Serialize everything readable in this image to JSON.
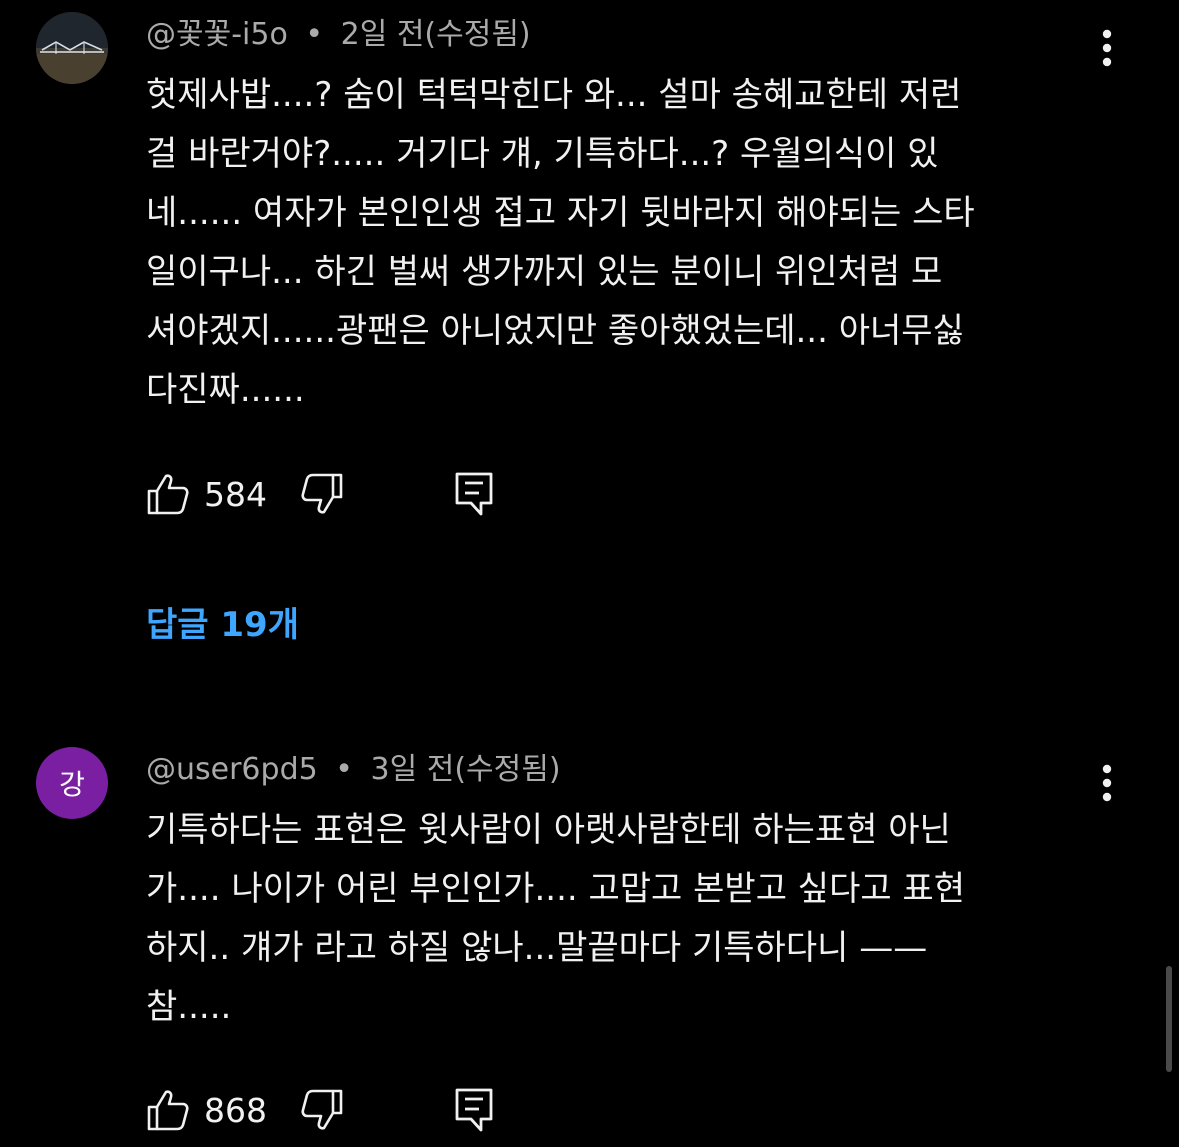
{
  "comments": [
    {
      "author": "@꽃꽃-i5o",
      "separator": "•",
      "time": "2일 전(수정됨)",
      "avatar_letter": "",
      "lines": [
        "헛제사밥....? 숨이 턱턱막힌다 와... 설마 송혜교한테 저런",
        "걸 바란거야?..... 거기다 걔, 기특하다...? 우월의식이 있",
        "네...... 여자가 본인인생 접고 자기 뒷바라지 해야되는 스타",
        "일이구나... 하긴 벌써 생가까지 있는 분이니 위인처럼 모",
        "셔야겠지......광팬은 아니었지만 좋아했었는데... 아너무싫",
        "다진짜......"
      ],
      "likes": "584",
      "replies_label": "답글 19개"
    },
    {
      "author": "@user6pd5",
      "separator": "•",
      "time": "3일 전(수정됨)",
      "avatar_letter": "강",
      "lines": [
        "기특하다는 표현은 윗사람이 아랫사람한테 하는표현 아닌",
        "가.... 나이가 어린 부인인가.... 고맙고 본받고 싶다고 표현",
        "하지.. 걔가 라고 하질 않나...말끝마다 기특하다니 ——",
        "참....."
      ],
      "likes": "868"
    }
  ],
  "icons": {
    "like": "thumbs-up-icon",
    "dislike": "thumbs-down-icon",
    "reply": "reply-comment-icon",
    "more": "more-vertical-icon"
  },
  "colors": {
    "background": "#000000",
    "text": "#f1f1f1",
    "meta": "#aaaaaa",
    "link": "#3ea6ff",
    "avatar_purple": "#7b1fa2"
  }
}
